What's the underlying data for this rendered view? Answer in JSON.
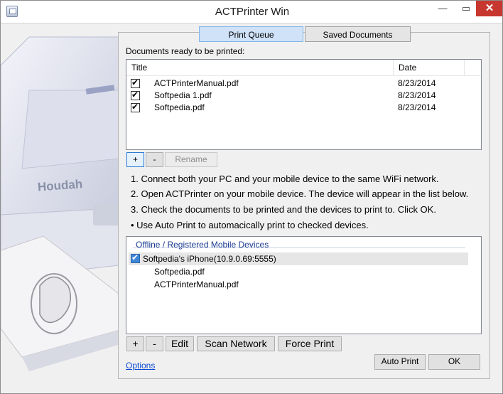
{
  "window": {
    "title": "ACTPrinter Win",
    "minimize": "—",
    "maximize": "▭",
    "close": "✕"
  },
  "tabs": [
    {
      "label": "Print Queue",
      "active": true
    },
    {
      "label": "Saved Documents",
      "active": false
    }
  ],
  "documents": {
    "label": "Documents ready to be printed:",
    "columns": [
      "Title",
      "Date"
    ],
    "rows": [
      {
        "checked": true,
        "title": "ACTPrinterManual.pdf",
        "date": "8/23/2014"
      },
      {
        "checked": true,
        "title": "Softpedia 1.pdf",
        "date": "8/23/2014"
      },
      {
        "checked": true,
        "title": "Softpedia.pdf",
        "date": "8/23/2014"
      }
    ],
    "add_label": "+",
    "remove_label": "-",
    "rename_label": "Rename"
  },
  "instructions": [
    "1. Connect both your PC and your mobile device to the same WiFi network.",
    "2. Open ACTPrinter on your mobile device.  The device will appear in the list below.",
    "3. Check the documents to be printed and the devices to print to.  Click OK.",
    "• Use Auto Print to automacically print to checked devices."
  ],
  "devices": {
    "header": "Offline / Registered Mobile Devices",
    "device_name": "Softpedia's iPhone(10.9.0.69:5555)",
    "device_checked": true,
    "files": [
      "Softpedia.pdf",
      "ACTPrinterManual.pdf"
    ]
  },
  "device_buttons": {
    "add": "+",
    "remove": "-",
    "edit": "Edit",
    "scan": "Scan Network",
    "force": "Force Print"
  },
  "footer": {
    "options": "Options",
    "auto_print": "Auto Print",
    "ok": "OK"
  },
  "art": {
    "printer_brand": "Houdah"
  },
  "colors": {
    "accent": "#2b7bd8",
    "link": "#0b4bd1",
    "close": "#c7372f"
  }
}
